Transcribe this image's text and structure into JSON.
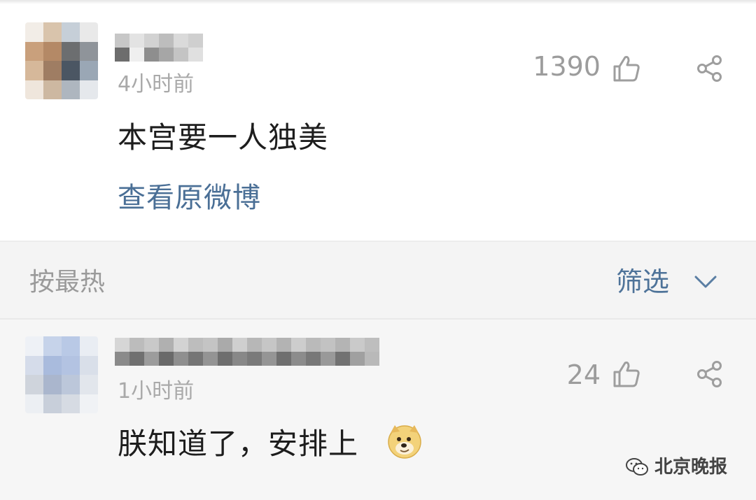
{
  "comments": [
    {
      "time": "4小时前",
      "likes": "1390",
      "text": "本宫要一人独美",
      "link": "查看原微博"
    },
    {
      "time": "1小时前",
      "likes": "24",
      "text": "朕知道了，安排上"
    }
  ],
  "sort_bar": {
    "label": "按最热",
    "filter": "筛选"
  },
  "watermark": {
    "text": "北京晚报"
  },
  "icons": {
    "like": "thumbs-up-icon",
    "share": "share-icon",
    "chevron": "chevron-down-icon",
    "emoji": "doge-emoji-icon",
    "wechat": "wechat-icon"
  }
}
